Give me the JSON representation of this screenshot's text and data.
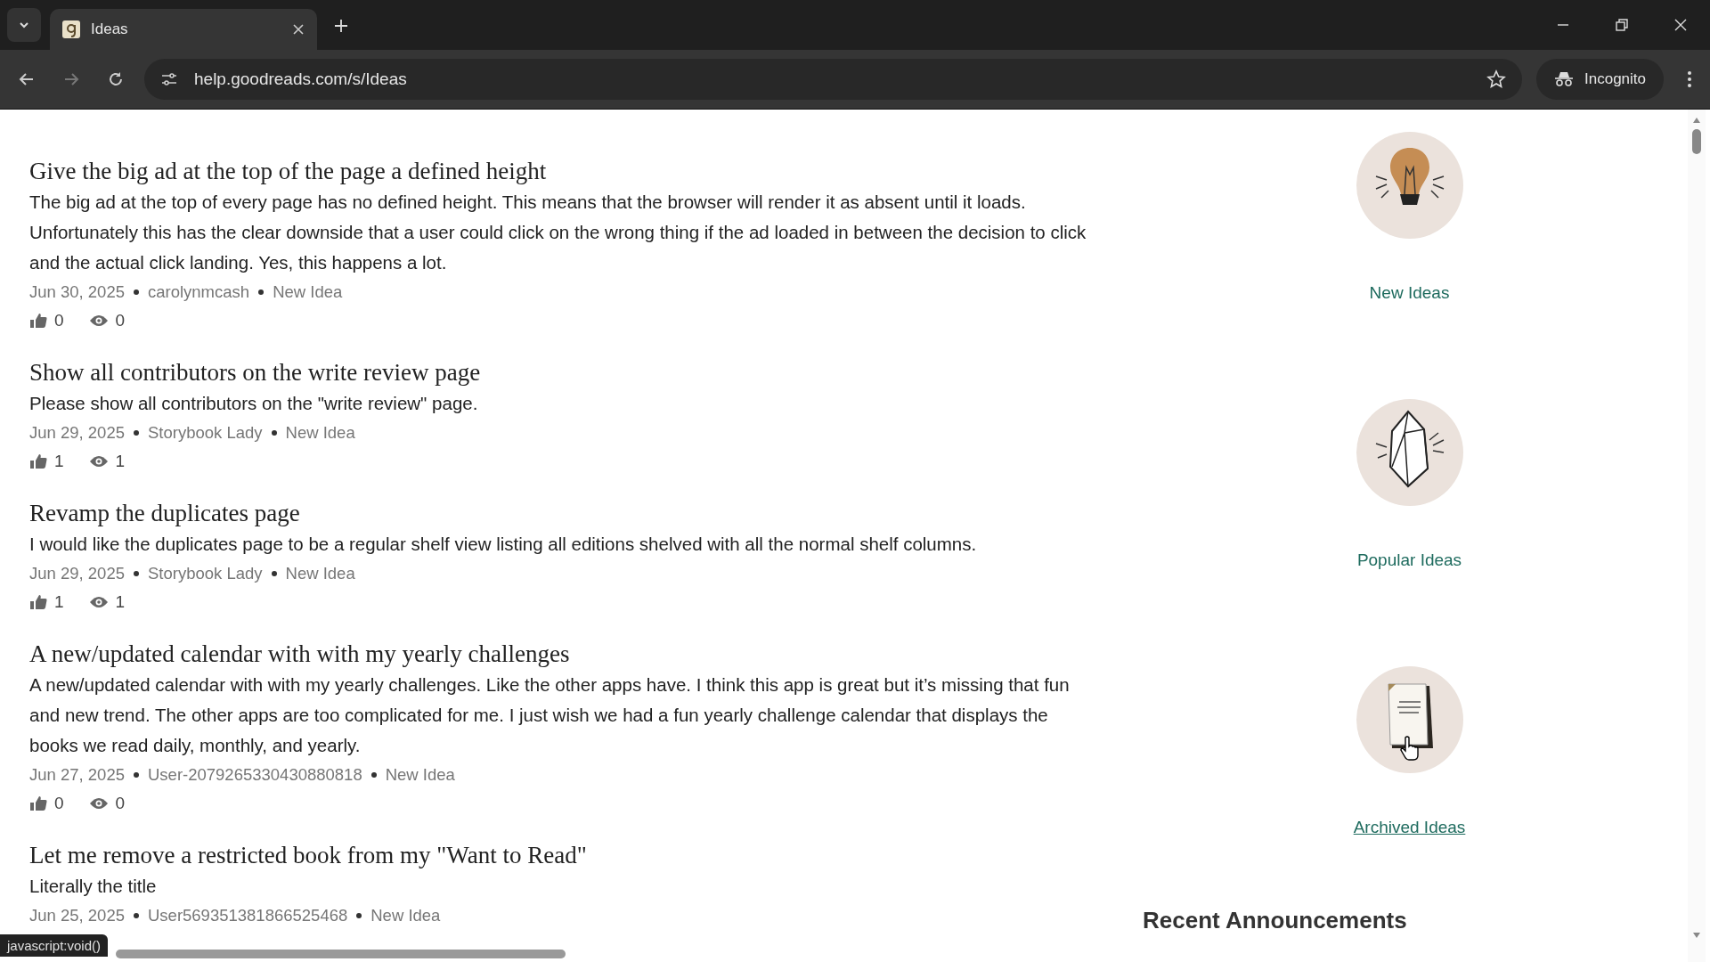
{
  "browser": {
    "tab_title": "Ideas",
    "url": "help.goodreads.com/s/Ideas",
    "profile": "Incognito"
  },
  "ideas": [
    {
      "title": "Give the big ad at the top of the page a defined height",
      "body": "The big ad at the top of every page has no defined height. This means that the browser will render it as absent until it loads. Unfortunately this has the clear downside that a user could click on the wrong thing if the ad loaded in between the decision to click and the actual click landing. Yes, this happens a lot.",
      "date": "Jun 30, 2025",
      "author": "carolynmcash",
      "status": "New Idea",
      "likes": "0",
      "views": "0"
    },
    {
      "title": "Show all contributors on the write review page",
      "body": "Please show all contributors on the \"write review\" page.",
      "date": "Jun 29, 2025",
      "author": "Storybook Lady",
      "status": "New Idea",
      "likes": "1",
      "views": "1"
    },
    {
      "title": "Revamp the duplicates page",
      "body": "I would like the duplicates page to be a regular shelf view listing all editions shelved with all the normal shelf columns.",
      "date": "Jun 29, 2025",
      "author": "Storybook Lady",
      "status": "New Idea",
      "likes": "1",
      "views": "1"
    },
    {
      "title": "A new/updated calendar with with my yearly challenges",
      "body": "A new/updated calendar with with my yearly challenges. Like the other apps have. I think this app is great but it’s missing that fun and new trend. The other apps are too complicated for me. I just wish we had a fun yearly challenge calendar that displays the books we read daily, monthly, and yearly.",
      "date": "Jun 27, 2025",
      "author": "User-2079265330430880818",
      "status": "New Idea",
      "likes": "0",
      "views": "0"
    },
    {
      "title": "Let me remove a restricted book from my \"Want to Read\"",
      "body": "Literally the title",
      "date": "Jun 25, 2025",
      "author": "User569351381866525468",
      "status": "New Idea"
    }
  ],
  "categories": [
    {
      "kind": "bulb",
      "label": "New Ideas",
      "hovered": false
    },
    {
      "kind": "gem",
      "label": "Popular Ideas",
      "hovered": false
    },
    {
      "kind": "papers",
      "label": "Archived Ideas",
      "hovered": true
    }
  ],
  "announcements_heading": "Recent Announcements",
  "status_text": "javascript:void()"
}
